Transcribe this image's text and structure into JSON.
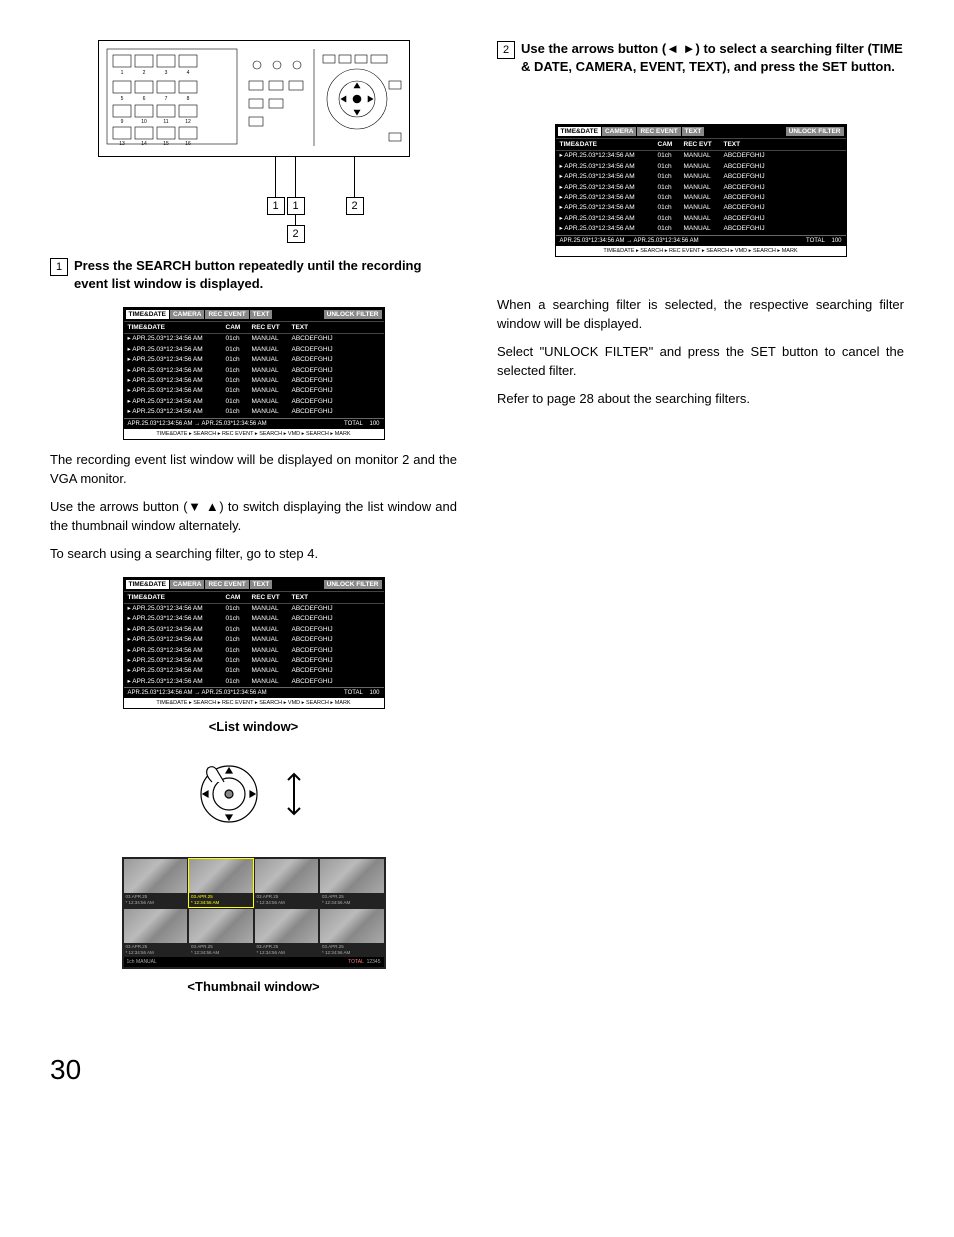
{
  "pageNumber": "30",
  "step1": {
    "num": "1",
    "text": "Press the SEARCH button repeatedly until the recording event list window is displayed."
  },
  "step2": {
    "num": "2",
    "text": "Use the arrows button (◄ ►) to select a searching filter (TIME & DATE, CAMERA, EVENT, TEXT), and press the SET button."
  },
  "callouts": {
    "a": "1",
    "b": "1",
    "c": "2",
    "d": "2"
  },
  "tabs": [
    "TIME&DATE",
    "CAMERA",
    "REC EVENT",
    "TEXT",
    "UNLOCK FILTER"
  ],
  "listHeader": {
    "date": "TIME&DATE",
    "cam": "CAM",
    "evt": "REC EVT",
    "text": "TEXT"
  },
  "listRows": [
    {
      "date": "▸ APR.25.03*12:34:56 AM",
      "cam": "01ch",
      "evt": "MANUAL",
      "text": "ABCDEFGHIJ"
    },
    {
      "date": "▸ APR.25.03*12:34:56 AM",
      "cam": "01ch",
      "evt": "MANUAL",
      "text": "ABCDEFGHIJ"
    },
    {
      "date": "▸ APR.25.03*12:34:56 AM",
      "cam": "01ch",
      "evt": "MANUAL",
      "text": "ABCDEFGHIJ"
    },
    {
      "date": "▸ APR.25.03*12:34:56 AM",
      "cam": "01ch",
      "evt": "MANUAL",
      "text": "ABCDEFGHIJ"
    },
    {
      "date": "▸ APR.25.03*12:34:56 AM",
      "cam": "01ch",
      "evt": "MANUAL",
      "text": "ABCDEFGHIJ"
    },
    {
      "date": "▸ APR.25.03*12:34:56 AM",
      "cam": "01ch",
      "evt": "MANUAL",
      "text": "ABCDEFGHIJ"
    },
    {
      "date": "▸ APR.25.03*12:34:56 AM",
      "cam": "01ch",
      "evt": "MANUAL",
      "text": "ABCDEFGHIJ"
    },
    {
      "date": "▸ APR.25.03*12:34:56 AM",
      "cam": "01ch",
      "evt": "MANUAL",
      "text": "ABCDEFGHIJ"
    }
  ],
  "listFooter": {
    "range": "APR.25.03*12:34:56 AM → APR.25.03*12:34:56 AM",
    "totalLabel": "TOTAL",
    "totalValue": "100",
    "breadcrumb": "TIME&DATE ▸ SEARCH ▸ REC EVENT ▸ SEARCH ▸ VMD ▸ SEARCH ▸ MARK"
  },
  "para1": "The recording event list window will be displayed on monitor 2 and the VGA monitor.",
  "para2": "Use the arrows button (▼ ▲) to switch displaying the list window and the thumbnail window alternately.",
  "para3": "To search using a searching filter, go to step 4.",
  "captionList": "<List window>",
  "captionThumb": "<Thumbnail window>",
  "para4": "When a searching filter is selected, the respective searching filter window will be displayed.",
  "para5": "Select \"UNLOCK FILTER\" and press the SET button to cancel the selected filter.",
  "para6": "Refer to page 28 about the searching filters.",
  "thumbs": [
    {
      "d": "03.APR.25",
      "t": "* 12:34:56 AM"
    },
    {
      "d": "03.APR.25",
      "t": "* 12:34:56 AM",
      "sel": true
    },
    {
      "d": "03.APR.25",
      "t": "* 12:34:56 AM"
    },
    {
      "d": "03.APR.25",
      "t": "* 12:34:56 AM"
    },
    {
      "d": "03.APR.25",
      "t": "* 12:34:56 AM"
    },
    {
      "d": "03.APR.25",
      "t": "* 12:34:56 AM"
    },
    {
      "d": "03.APR.25",
      "t": "* 12:34:56 AM"
    },
    {
      "d": "03.APR.25",
      "t": "* 12:34:56 AM"
    }
  ],
  "thumbFooter": {
    "left": "1ch MANUAL",
    "rlabel": "TOTAL",
    "rval": "12345"
  }
}
